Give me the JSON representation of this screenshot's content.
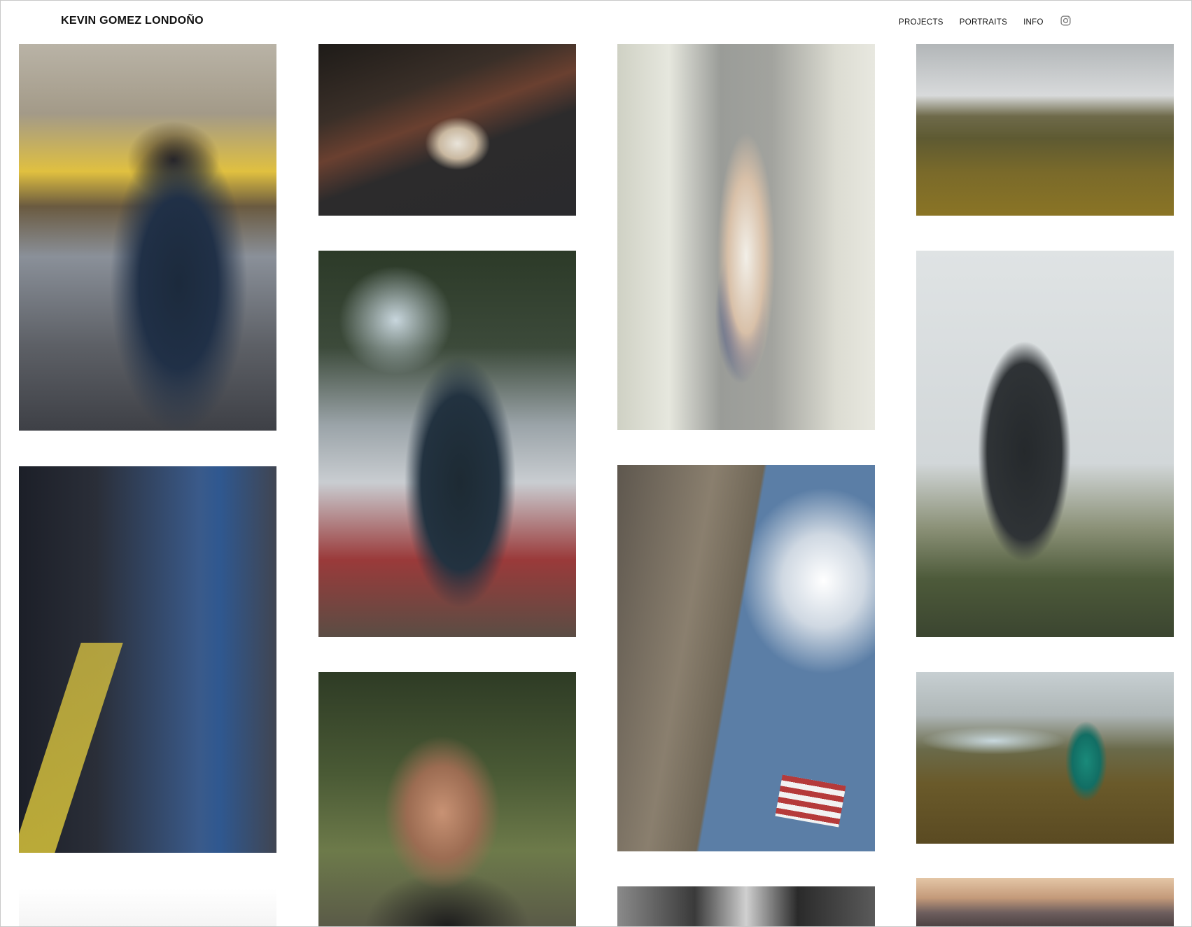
{
  "site": {
    "title": "KEVIN GOMEZ LONDOÑO"
  },
  "nav": {
    "projects": "PROJECTS",
    "portraits": "PORTRAITS",
    "info": "INFO",
    "instagram_icon": "instagram-icon"
  },
  "colors": {
    "text": "#111111",
    "background": "#ffffff"
  }
}
